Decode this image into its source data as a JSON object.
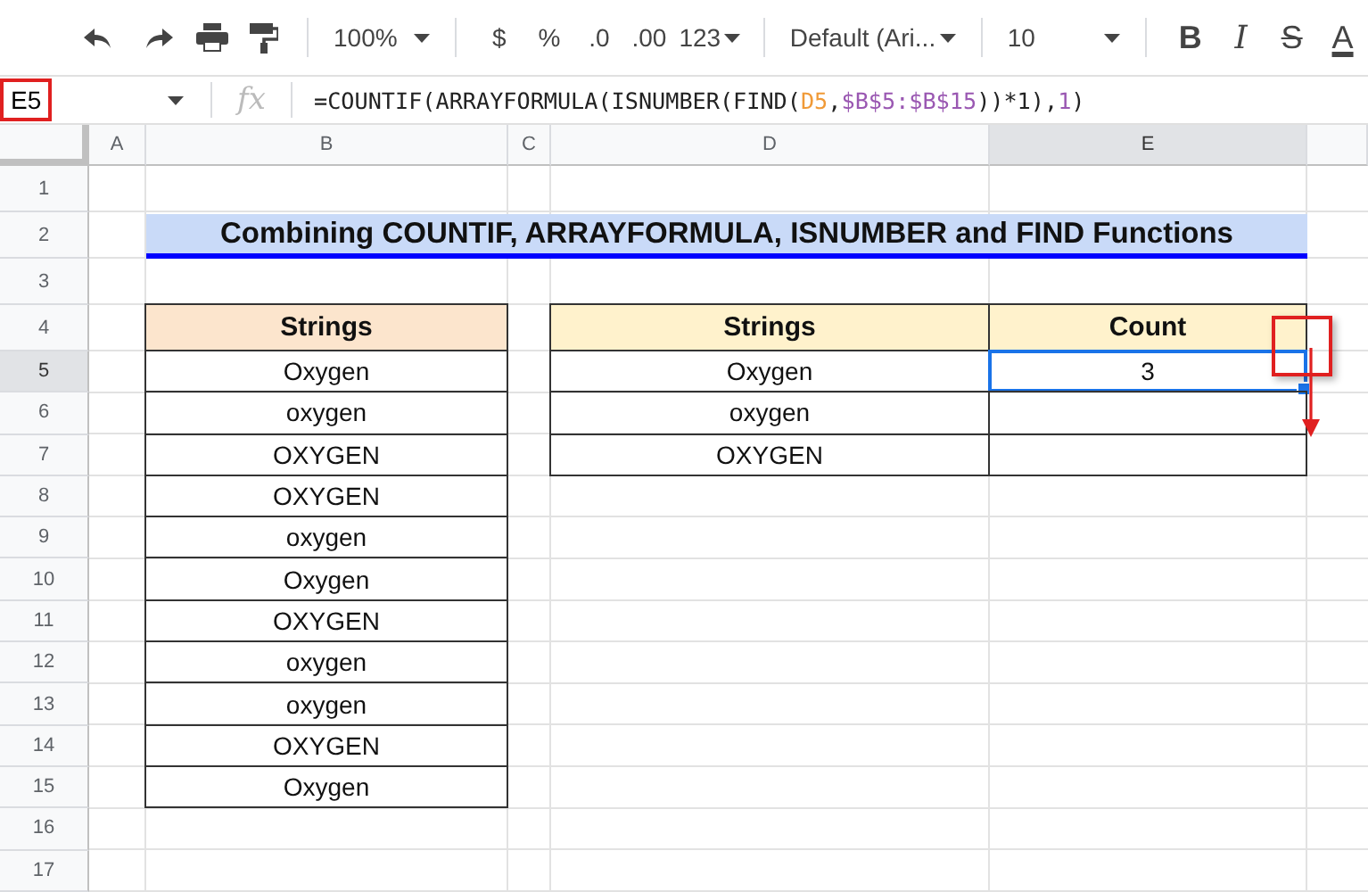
{
  "toolbar": {
    "zoom": "100%",
    "format_buttons": [
      "$",
      "%",
      ".0",
      ".00",
      "123"
    ],
    "font": "Default (Ari...",
    "font_size": "10",
    "style_buttons": [
      "B",
      "I",
      "S",
      "A"
    ]
  },
  "name_box": {
    "text": "E5",
    "highlighted": true
  },
  "formula_bar": {
    "icon": "fx",
    "parts": [
      {
        "text": "=COUNTIF(ARRAYFORMULA(ISNUMBER(FIND(",
        "color": "#222222"
      },
      {
        "text": "D5",
        "color": "#f09a37"
      },
      {
        "text": ",",
        "color": "#222222"
      },
      {
        "text": "$B$5:$B$15",
        "color": "#9a58b2"
      },
      {
        "text": "))*1),",
        "color": "#222222"
      },
      {
        "text": "1",
        "color": "#9a58b2"
      },
      {
        "text": ")",
        "color": "#222222"
      }
    ]
  },
  "columns": [
    {
      "label": "A",
      "selected": false
    },
    {
      "label": "B",
      "selected": false
    },
    {
      "label": "C",
      "selected": false
    },
    {
      "label": "D",
      "selected": false
    },
    {
      "label": "E",
      "selected": true
    }
  ],
  "rows": [
    {
      "label": "1",
      "selected": false
    },
    {
      "label": "2",
      "selected": false
    },
    {
      "label": "3",
      "selected": false
    },
    {
      "label": "4",
      "selected": false
    },
    {
      "label": "5",
      "selected": true
    },
    {
      "label": "6",
      "selected": false
    },
    {
      "label": "7",
      "selected": false
    },
    {
      "label": "8",
      "selected": false
    },
    {
      "label": "9",
      "selected": false
    },
    {
      "label": "10",
      "selected": false
    },
    {
      "label": "11",
      "selected": false
    },
    {
      "label": "12",
      "selected": false
    },
    {
      "label": "13",
      "selected": false
    },
    {
      "label": "14",
      "selected": false
    },
    {
      "label": "15",
      "selected": false
    },
    {
      "label": "16",
      "selected": false
    },
    {
      "label": "17",
      "selected": false
    }
  ],
  "title": "Combining COUNTIF, ARRAYFORMULA, ISNUMBER and FIND Functions",
  "tables": [
    {
      "kind": "peach",
      "headers": [
        "Strings"
      ],
      "rows": [
        [
          {
            "text": "Oxygen",
            "selected": false
          }
        ],
        [
          {
            "text": "oxygen",
            "selected": false
          }
        ],
        [
          {
            "text": "OXYGEN",
            "selected": false
          }
        ],
        [
          {
            "text": "OXYGEN",
            "selected": false
          }
        ],
        [
          {
            "text": "oxygen",
            "selected": false
          }
        ],
        [
          {
            "text": "Oxygen",
            "selected": false
          }
        ],
        [
          {
            "text": "OXYGEN",
            "selected": false
          }
        ],
        [
          {
            "text": "oxygen",
            "selected": false
          }
        ],
        [
          {
            "text": "oxygen",
            "selected": false
          }
        ],
        [
          {
            "text": "OXYGEN",
            "selected": false
          }
        ],
        [
          {
            "text": "Oxygen",
            "selected": false
          }
        ]
      ]
    },
    {
      "kind": "cream",
      "headers": [
        "Strings",
        "Count"
      ],
      "rows": [
        [
          {
            "text": "Oxygen",
            "selected": false
          },
          {
            "text": "3",
            "selected": true
          }
        ],
        [
          {
            "text": "oxygen",
            "selected": false
          },
          {
            "selected": false
          }
        ],
        [
          {
            "text": "OXYGEN",
            "selected": false
          },
          {
            "selected": false
          }
        ]
      ]
    }
  ],
  "annotations": [
    {
      "kind": "box"
    },
    {
      "kind": "arrow"
    }
  ]
}
